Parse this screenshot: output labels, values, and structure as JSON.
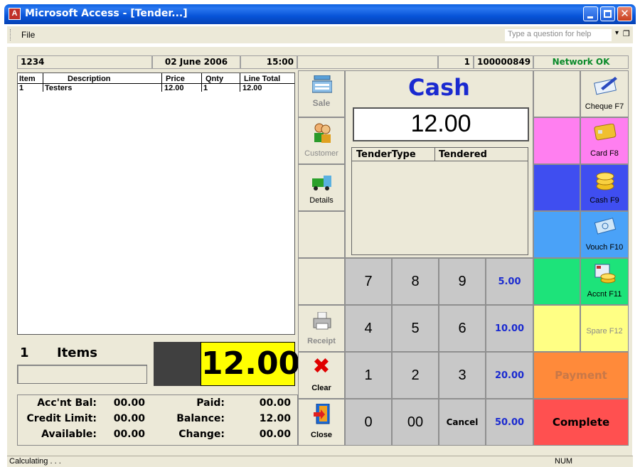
{
  "window": {
    "title": "Microsoft Access - [Tender...]",
    "menu_file": "File",
    "help_placeholder": "Type a question for help"
  },
  "header": {
    "account": "1234",
    "date": "02 June 2006",
    "time": "15:00",
    "count": "1",
    "transaction": "100000849",
    "network": "Network OK"
  },
  "items_table": {
    "columns": [
      "Item",
      "Description",
      "Price",
      "Qnty",
      "Line Total"
    ],
    "rows": [
      {
        "item": "1",
        "description": "Testers",
        "price": "12.00",
        "qnty": "1",
        "line_total": "12.00"
      }
    ]
  },
  "summary": {
    "items_count": "1",
    "items_label": "Items",
    "total": "12.00"
  },
  "balances": {
    "acc_bal_label": "Acc'nt Bal:",
    "acc_bal": "00.00",
    "credit_limit_label": "Credit Limit:",
    "credit_limit": "00.00",
    "available_label": "Available:",
    "available": "00.00",
    "paid_label": "Paid:",
    "paid": "00.00",
    "balance_label": "Balance:",
    "balance": "12.00",
    "change_label": "Change:",
    "change": "00.00"
  },
  "tender": {
    "type_title": "Cash",
    "amount": "12.00",
    "col_type": "TenderType",
    "col_tendered": "Tendered"
  },
  "left_tools": {
    "sale": "Sale",
    "customer": "Customer",
    "details": "Details",
    "receipt": "Receipt",
    "clear": "Clear",
    "close": "Close"
  },
  "keypad": {
    "row1": [
      "7",
      "8",
      "9",
      "5.00"
    ],
    "row2": [
      "4",
      "5",
      "6",
      "10.00"
    ],
    "row3": [
      "1",
      "2",
      "3",
      "20.00"
    ],
    "row4": [
      "0",
      "00",
      "Cancel",
      "50.00"
    ]
  },
  "tender_buttons": {
    "cheque": "Cheque F7",
    "card": "Card F8",
    "cash": "Cash F9",
    "voucher": "Vouch F10",
    "account": "Accnt F11",
    "spare": "Spare F12",
    "payment": "Payment",
    "complete": "Complete"
  },
  "colors": {
    "pink": "#ff7ff0",
    "blue": "#3f4ef0",
    "lightblue": "#4aa2f8",
    "green": "#1de37a",
    "yellow": "#ffff84",
    "orange": "#ff8a3a",
    "red": "#ff5050",
    "total_bg": "#ffff00",
    "cash_title": "#1a2ad0"
  },
  "statusbar": {
    "text": "Calculating . . .",
    "num": "NUM"
  }
}
